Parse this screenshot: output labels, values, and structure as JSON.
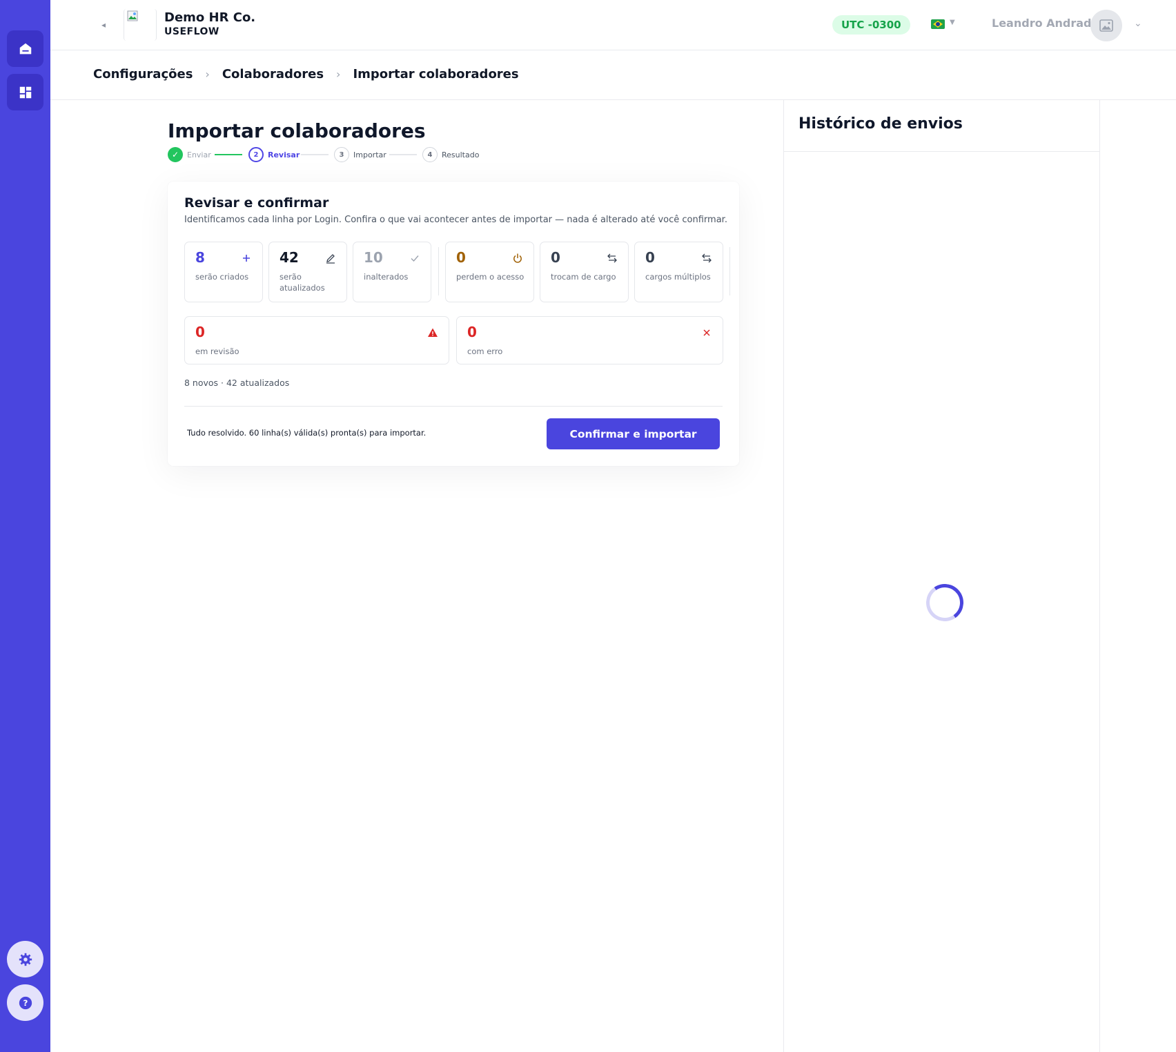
{
  "company": {
    "name": "Demo HR Co.",
    "subtitle": "USEFLOW"
  },
  "header": {
    "timezone": "UTC -0300",
    "user_name": "Leandro Andrade",
    "language": "pt-BR"
  },
  "breadcrumb": [
    "Configurações",
    "Colaboradores",
    "Importar colaboradores"
  ],
  "page": {
    "title": "Importar colaboradores"
  },
  "steps": [
    {
      "number": "✓",
      "label": "Enviar",
      "state": "done"
    },
    {
      "number": "2",
      "label": "Revisar",
      "state": "active"
    },
    {
      "number": "3",
      "label": "Importar",
      "state": "todo"
    },
    {
      "number": "4",
      "label": "Resultado",
      "state": "todo"
    }
  ],
  "review": {
    "title": "Revisar e confirmar",
    "subtitle": "Identificamos cada linha por Login. Confira o que vai acontecer antes de importar — nada é alterado até você confirmar.",
    "stats": [
      {
        "value": "8",
        "label": "serão criados",
        "icon": "plus-icon",
        "color": "#4a45de"
      },
      {
        "value": "42",
        "label": "serão atualizados",
        "icon": "pencil-icon",
        "color": "#111827"
      },
      {
        "value": "10",
        "label": "inalterados",
        "icon": "check-icon",
        "color": "#9ca3af"
      },
      {
        "value": "0",
        "label": "perdem o acesso",
        "icon": "power-icon",
        "color": "#a16207"
      },
      {
        "value": "0",
        "label": "trocam de cargo",
        "icon": "swap-icon",
        "color": "#374151"
      },
      {
        "value": "0",
        "label": "cargos múltiplos",
        "icon": "swap-icon",
        "color": "#374151"
      }
    ],
    "alerts": [
      {
        "value": "0",
        "label": "em revisão",
        "icon": "warning-icon",
        "color": "#dc2626"
      },
      {
        "value": "0",
        "label": "com erro",
        "icon": "close-icon",
        "color": "#dc2626"
      }
    ],
    "summary": "8 novos · 42 atualizados",
    "status_message": "Tudo resolvido. 60 linha(s) válida(s) pronta(s) para importar.",
    "confirm_label": "Confirmar e importar"
  },
  "history": {
    "title": "Histórico de envios"
  },
  "colors": {
    "primary": "#4a45de",
    "success": "#22c55e",
    "danger": "#dc2626",
    "warning": "#a16207"
  }
}
